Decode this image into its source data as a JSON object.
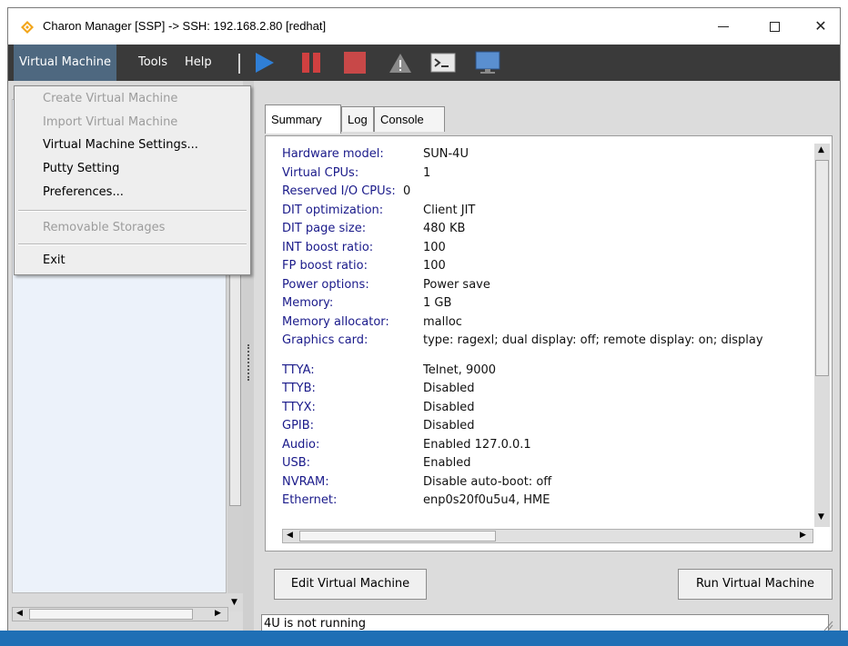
{
  "window": {
    "title": "Charon Manager [SSP] -> SSH: 192.168.2.80 [redhat]",
    "minimize": "minimize",
    "maximize": "maximize",
    "close": "✕"
  },
  "menubar": {
    "vm": "Virtual Machine",
    "tools": "Tools",
    "help": "Help"
  },
  "toolbar": {
    "icons": [
      "play-icon",
      "pause-icon",
      "stop-icon",
      "warning-icon",
      "terminal-icon",
      "monitor-icon"
    ]
  },
  "dropdown": {
    "items": [
      {
        "label": "Create Virtual Machine",
        "enabled": false
      },
      {
        "label": "Import Virtual Machine",
        "enabled": false
      },
      {
        "label": "Virtual Machine Settings...",
        "enabled": true
      },
      {
        "label": "Putty Setting",
        "enabled": true
      },
      {
        "label": "Preferences...",
        "enabled": true
      },
      {
        "label": "Removable Storages",
        "enabled": false
      },
      {
        "label": "Exit",
        "enabled": true
      }
    ]
  },
  "tabs": [
    "Summary",
    "Log",
    "Console"
  ],
  "summary": {
    "rows": [
      {
        "label": "Hardware model:",
        "value": "SUN-4U"
      },
      {
        "label": "Virtual CPUs:",
        "value": "1"
      },
      {
        "label": "Reserved I/O CPUs:",
        "value": "0"
      },
      {
        "label": "DIT optimization:",
        "value": "Client JIT"
      },
      {
        "label": "DIT page size:",
        "value": "480 KB"
      },
      {
        "label": "INT boost ratio:",
        "value": "100"
      },
      {
        "label": "FP boost ratio:",
        "value": "100"
      },
      {
        "label": "Power options:",
        "value": "Power save"
      },
      {
        "label": "Memory:",
        "value": "1 GB"
      },
      {
        "label": "Memory allocator:",
        "value": "malloc"
      },
      {
        "label": "Graphics card:",
        "value": "type: ragexl; dual display: off; remote display: on; display"
      }
    ],
    "rows2": [
      {
        "label": "TTYA:",
        "value": "Telnet, 9000"
      },
      {
        "label": "TTYB:",
        "value": "Disabled"
      },
      {
        "label": "TTYX:",
        "value": "Disabled"
      },
      {
        "label": "GPIB:",
        "value": "Disabled"
      },
      {
        "label": "Audio:",
        "value": "Enabled 127.0.0.1"
      },
      {
        "label": "USB:",
        "value": "Enabled"
      },
      {
        "label": "NVRAM:",
        "value": "Disable auto-boot: off"
      },
      {
        "label": "Ethernet:",
        "value": "enp0s20f0u5u4, HME"
      }
    ]
  },
  "buttons": {
    "edit": "Edit Virtual Machine",
    "run": "Run Virtual Machine"
  },
  "status": {
    "text": "4U is not running"
  },
  "colors": {
    "menubar": "#3a3a3a",
    "menu_active": "#4e6880",
    "label_blue": "#1a1a8a",
    "play_blue": "#2f7fd6",
    "pause_red": "#d04040"
  }
}
